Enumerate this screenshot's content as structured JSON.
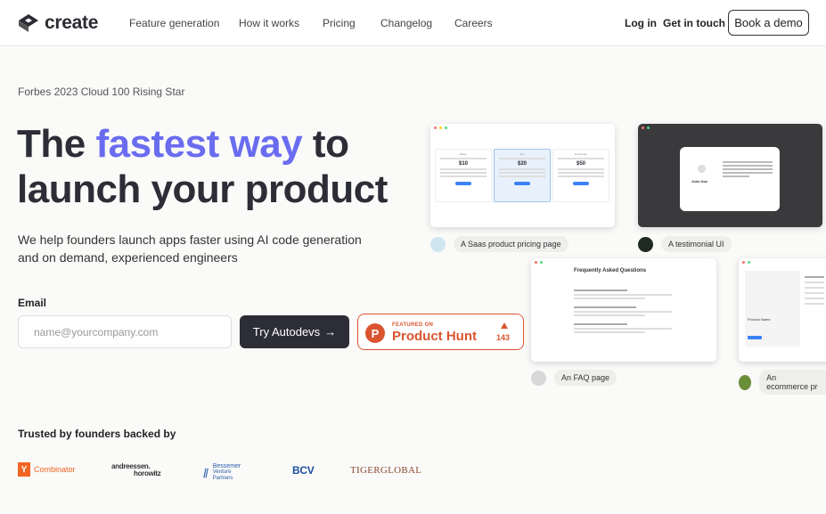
{
  "nav": {
    "logo_text": "create",
    "links": [
      "Feature generation",
      "How it works",
      "Pricing",
      "Changelog",
      "Careers"
    ],
    "login": "Log in",
    "contact": "Get in touch",
    "demo": "Book a demo"
  },
  "hero": {
    "eyebrow": "Forbes 2023 Cloud 100 Rising Star",
    "headline_pre": "The ",
    "headline_accent": "fastest way",
    "headline_post": " to",
    "headline_line2": "launch your product",
    "subtitle": "We help founders launch apps faster using AI code generation and on demand, experienced engineers",
    "email_label": "Email",
    "email_placeholder": "name@yourcompany.com",
    "cta": "Try Autodevs",
    "cta_arrow": "→"
  },
  "product_hunt": {
    "featured": "FEATURED ON",
    "name": "Product Hunt",
    "count": "143"
  },
  "trusted": {
    "label": "Trusted by founders backed by",
    "yc": "Combinator",
    "a16z_1": "andreessen.",
    "a16z_2": "horowitz",
    "bessemer_1": "Bessemer",
    "bessemer_2": "Venture Partners",
    "bcv": "BCV",
    "tiger": "TIGERGLOBAL"
  },
  "examples": [
    {
      "caption": "A Saas product pricing page"
    },
    {
      "caption": "A testimonial UI"
    },
    {
      "caption": "An FAQ page"
    },
    {
      "caption": "An ecommerce pr"
    }
  ],
  "mock": {
    "faq_title": "Frequently Asked Questions",
    "testimonial_name": "John Doe",
    "prices": [
      "$10",
      "$20",
      "$50"
    ],
    "product_name": "Product Name"
  },
  "colors": {
    "accent": "#6a6cf0",
    "dark": "#2c2d36",
    "product_hunt": "#da552f"
  }
}
